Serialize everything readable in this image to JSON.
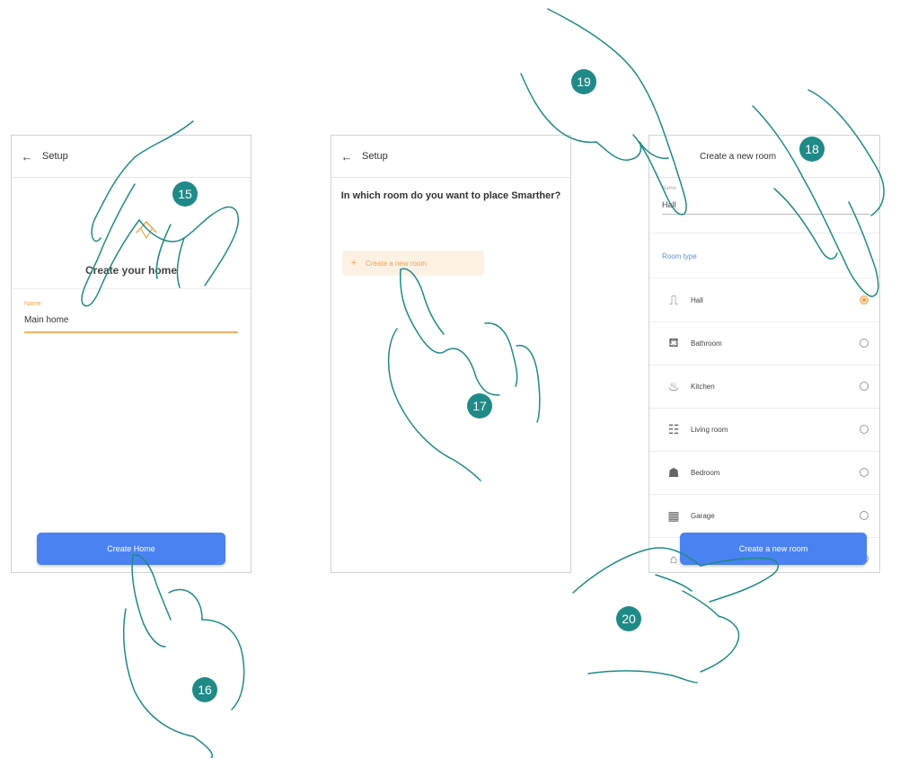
{
  "screen1": {
    "header_title": "Setup",
    "heading": "Create your home",
    "name_label": "Name",
    "name_value": "Main home",
    "button": "Create Home"
  },
  "screen2": {
    "header_title": "Setup",
    "question": "In which room do you want to place Smarther?",
    "create_room": "Create a new room"
  },
  "screen3": {
    "header_title": "Create a new room",
    "name_label": "Name",
    "name_value": "Hall",
    "room_type_label": "Room type",
    "rooms": [
      {
        "label": "Hall",
        "icon": "⎍",
        "selected": true
      },
      {
        "label": "Bathroom",
        "icon": "⛾",
        "selected": false
      },
      {
        "label": "Kitchen",
        "icon": "♨",
        "selected": false
      },
      {
        "label": "Living room",
        "icon": "☷",
        "selected": false
      },
      {
        "label": "Bedroom",
        "icon": "☗",
        "selected": false
      },
      {
        "label": "Garage",
        "icon": "▦",
        "selected": false
      }
    ],
    "button": "Create a new room"
  },
  "steps": [
    "15",
    "16",
    "17",
    "18",
    "19",
    "20"
  ],
  "colors": {
    "accent": "#f2a24a",
    "primary_button": "#4b82f2",
    "step_badge": "#1f8a87",
    "hand_outline": "#1f8a87"
  }
}
